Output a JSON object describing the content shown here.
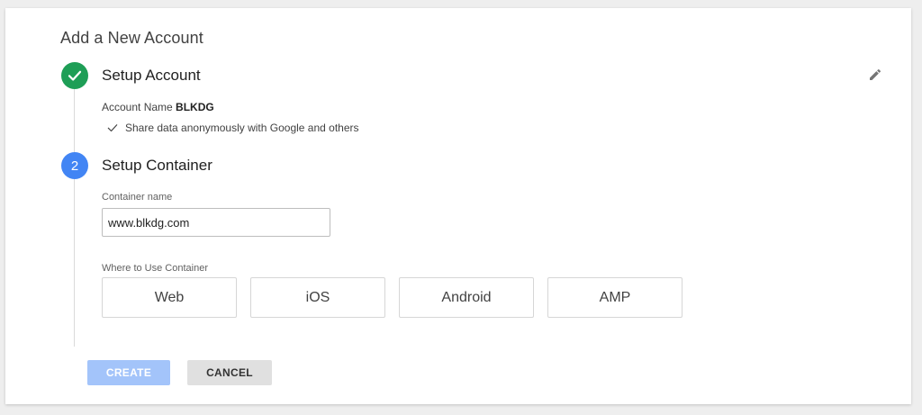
{
  "page": {
    "title": "Add a New Account"
  },
  "step1": {
    "title": "Setup Account",
    "status": "complete",
    "account_name_label": "Account Name",
    "account_name_value": "BLKDG",
    "share_data_text": "Share data anonymously with Google and others",
    "edit_icon": "pencil-icon",
    "color": "#1e9e56"
  },
  "step2": {
    "number": "2",
    "title": "Setup Container",
    "color": "#4285f4",
    "container_name_label": "Container name",
    "container_name_value": "www.blkdg.com",
    "where_label": "Where to Use Container",
    "platforms": [
      {
        "label": "Web"
      },
      {
        "label": "iOS"
      },
      {
        "label": "Android"
      },
      {
        "label": "AMP"
      }
    ]
  },
  "actions": {
    "create_label": "CREATE",
    "cancel_label": "CANCEL",
    "create_color": "#a3c4fa"
  }
}
